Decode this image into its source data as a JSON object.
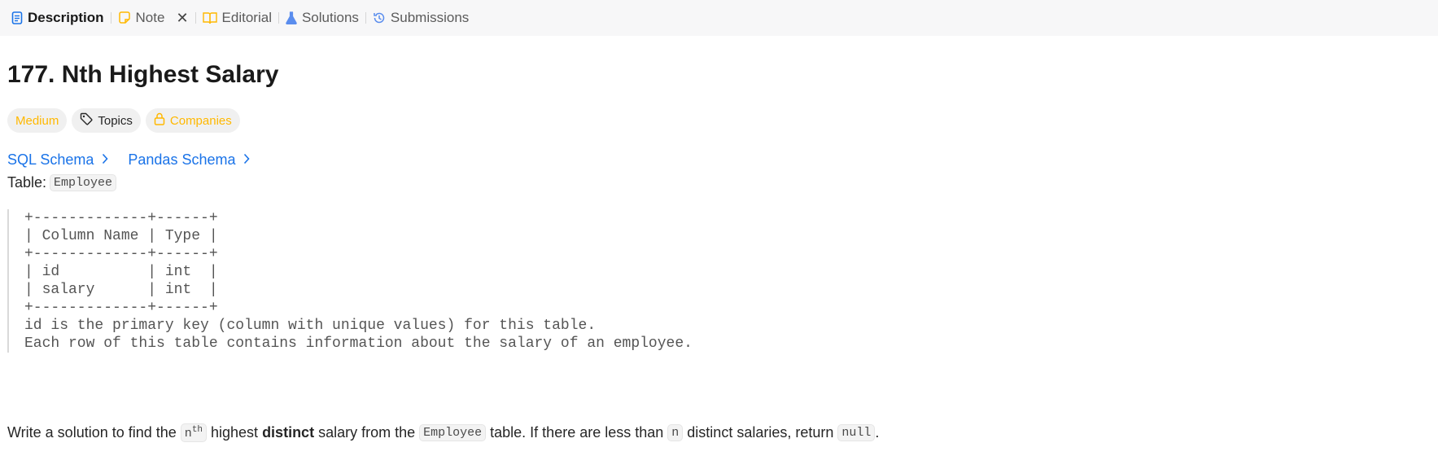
{
  "tabs": [
    {
      "label": "Description",
      "icon": "document-icon",
      "active": true
    },
    {
      "label": "Note",
      "icon": "note-icon",
      "closable": true
    },
    {
      "label": "Editorial",
      "icon": "book-icon"
    },
    {
      "label": "Solutions",
      "icon": "flask-icon"
    },
    {
      "label": "Submissions",
      "icon": "history-icon"
    }
  ],
  "problem": {
    "title": "177. Nth Highest Salary",
    "badges": {
      "difficulty": "Medium",
      "topics": "Topics",
      "companies": "Companies"
    },
    "schemas": {
      "sql": "SQL Schema",
      "pandas": "Pandas Schema"
    },
    "table_label": "Table:",
    "table_name": "Employee",
    "schema_block": "+-------------+------+\n| Column Name | Type |\n+-------------+------+\n| id          | int  |\n| salary      | int  |\n+-------------+------+\nid is the primary key (column with unique values) for this table.\nEach row of this table contains information about the salary of an employee.",
    "statement": {
      "part1": "Write a solution to find the",
      "n": "n",
      "th": "th",
      "part2": "highest",
      "bold": "distinct",
      "part3": "salary from the",
      "table_code": "Employee",
      "part4": "table. If there are less than",
      "n_code": "n",
      "part5": "distinct salaries, return",
      "null_code": "null",
      "end": "."
    }
  },
  "colors": {
    "medium": "#ffb800",
    "link": "#1a73e8",
    "tabbar_bg": "#f7f7f8"
  }
}
